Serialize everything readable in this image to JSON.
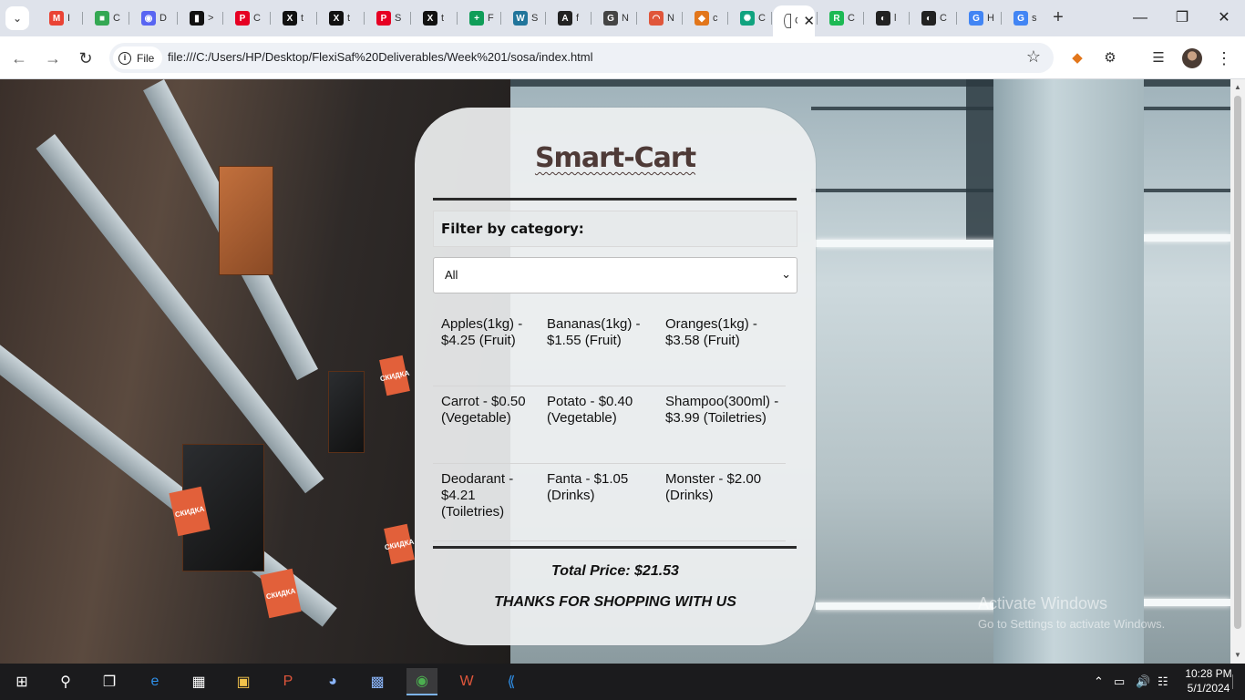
{
  "browser": {
    "tabs": [
      {
        "icon": "gmail-icon",
        "glyph": "M",
        "color": "#ea4335",
        "title": "I"
      },
      {
        "icon": "google-meet-icon",
        "glyph": "■",
        "color": "#34a853",
        "title": "C"
      },
      {
        "icon": "discord-icon",
        "glyph": "◉",
        "color": "#5865f2",
        "title": "D"
      },
      {
        "icon": "notion-icon",
        "glyph": "▮",
        "color": "#111111",
        "title": ">"
      },
      {
        "icon": "pinterest-icon",
        "glyph": "P",
        "color": "#e60023",
        "title": "C"
      },
      {
        "icon": "x-icon",
        "glyph": "X",
        "color": "#111111",
        "title": "t"
      },
      {
        "icon": "x-icon",
        "glyph": "X",
        "color": "#111111",
        "title": "t"
      },
      {
        "icon": "pinterest-icon",
        "glyph": "P",
        "color": "#e60023",
        "title": "S"
      },
      {
        "icon": "x-icon",
        "glyph": "X",
        "color": "#111111",
        "title": "t"
      },
      {
        "icon": "google-sheets-icon",
        "glyph": "+",
        "color": "#0f9d58",
        "title": "F"
      },
      {
        "icon": "wordpress-icon",
        "glyph": "W",
        "color": "#21759b",
        "title": "S"
      },
      {
        "icon": "app-icon",
        "glyph": "A",
        "color": "#222222",
        "title": "f"
      },
      {
        "icon": "doc-icon",
        "glyph": "G",
        "color": "#444444",
        "title": "N"
      },
      {
        "icon": "rainbow-icon",
        "glyph": "◠",
        "color": "#e0563b",
        "title": "N"
      },
      {
        "icon": "metamask-icon",
        "glyph": "◆",
        "color": "#e2761b",
        "title": "c"
      },
      {
        "icon": "chatgpt-icon",
        "glyph": "✺",
        "color": "#10a37f",
        "title": "C"
      },
      {
        "icon": "page-icon",
        "glyph": "",
        "color": "#ffffff",
        "title": "C"
      },
      {
        "icon": "replit-icon",
        "glyph": "R",
        "color": "#1db954",
        "title": "C"
      },
      {
        "icon": "github-icon",
        "glyph": "◐",
        "color": "#222222",
        "title": "l"
      },
      {
        "icon": "github-icon",
        "glyph": "◐",
        "color": "#222222",
        "title": "C"
      },
      {
        "icon": "google-icon",
        "glyph": "G",
        "color": "#4285f4",
        "title": "H"
      },
      {
        "icon": "google-icon",
        "glyph": "G",
        "color": "#4285f4",
        "title": "s"
      }
    ],
    "url_scheme": "File",
    "url": "file:///C:/Users/HP/Desktop/FlexiSaf%20Deliverables/Week%201/sosa/index.html"
  },
  "app": {
    "title": "Smart-Cart",
    "filter_label": "Filter by category:",
    "filter_selected": "All",
    "products": [
      [
        "Apples(1kg) - $4.25 (Fruit)",
        "Bananas(1kg) - $1.55 (Fruit)",
        "Oranges(1kg) - $3.58 (Fruit)"
      ],
      [
        "Carrot - $0.50 (Vegetable)",
        "Potato - $0.40 (Vegetable)",
        "Shampoo(300ml) - $3.99 (Toiletries)"
      ],
      [
        "Deodarant - $4.21 (Toiletries)",
        "Fanta - $1.05 (Drinks)",
        "Monster - $2.00 (Drinks)"
      ]
    ],
    "total": "Total Price: $21.53",
    "thanks": "THANKS FOR SHOPPING WITH US"
  },
  "watermark": {
    "line1": "Activate Windows",
    "line2": "Go to Settings to activate Windows."
  },
  "taskbar": {
    "time": "10:28 PM",
    "date": "5/1/2024"
  }
}
